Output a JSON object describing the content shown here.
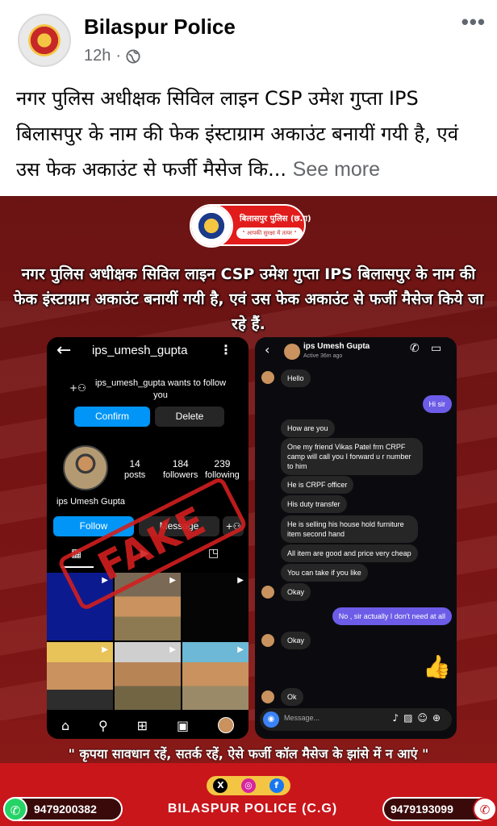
{
  "post": {
    "page_name": "Bilaspur Police",
    "time": "12h",
    "meta_separator": "·",
    "more_icon": "•••",
    "text": "नगर पुलिस अधीक्षक सिविल लाइन CSP उमेश गुप्ता IPS बिलासपुर के नाम की फेक इंस्टाग्राम अकाउंट बनायीं गयी है, एवं उस फेक अकाउंट से फर्जी मैसेज कि...",
    "see_more": "See more"
  },
  "image": {
    "logo_title": "बिलासपुर पुलिस (छ.ग)",
    "logo_tagline": "\" आपकी सुरक्षा में तत्पर \"",
    "headline": "नगर पुलिस अधीक्षक सिविल लाइन CSP उमेश गुप्ता IPS बिलासपुर के नाम की फेक इंस्टाग्राम अकाउंट बनायीं गयी है, एवं उस फेक अकाउंट से फर्जी मैसेज किये जा रहे हैं.",
    "fake_stamp": "FAKE",
    "warning": "\" कृपया सावधान रहें, सतर्क रहें, ऐसे फर्जी कॉल मैसेज के झांसे में न आएं \"",
    "phone_left": "9479200382",
    "phone_right": "9479193099",
    "brand": "BILASPUR POLICE (C.G)"
  },
  "instagram_profile": {
    "username": "ips_umesh_gupta",
    "follow_request": "ips_umesh_gupta wants to follow you",
    "confirm": "Confirm",
    "delete": "Delete",
    "posts": "14",
    "posts_label": "posts",
    "followers": "184",
    "followers_label": "followers",
    "following": "239",
    "following_label": "following",
    "display_name": "ips Umesh Gupta",
    "follow": "Follow",
    "message": "Message"
  },
  "chat": {
    "name": "ips Umesh Gupta",
    "status": "Active 36m ago",
    "messages": [
      {
        "dir": "in",
        "text": "Hello"
      },
      {
        "dir": "out",
        "text": "Hi sir"
      },
      {
        "dir": "in",
        "text": "How are you"
      },
      {
        "dir": "in",
        "text": "One my friend Vikas Patel frm CRPF camp will call you I forward u r number to him"
      },
      {
        "dir": "in",
        "text": "He is CRPF officer"
      },
      {
        "dir": "in",
        "text": "His duty transfer"
      },
      {
        "dir": "in",
        "text": "He is selling his house hold  furniture item second hand"
      },
      {
        "dir": "in",
        "text": "All item are good and price very cheap"
      },
      {
        "dir": "in",
        "text": "You can take if you like"
      },
      {
        "dir": "in",
        "text": "Okay"
      },
      {
        "dir": "out",
        "text": "No , sir actually I don't need at all"
      },
      {
        "dir": "in",
        "text": "Okay"
      },
      {
        "dir": "in",
        "text": "Ok"
      }
    ],
    "thumbs": "👍",
    "placeholder": "Message..."
  }
}
